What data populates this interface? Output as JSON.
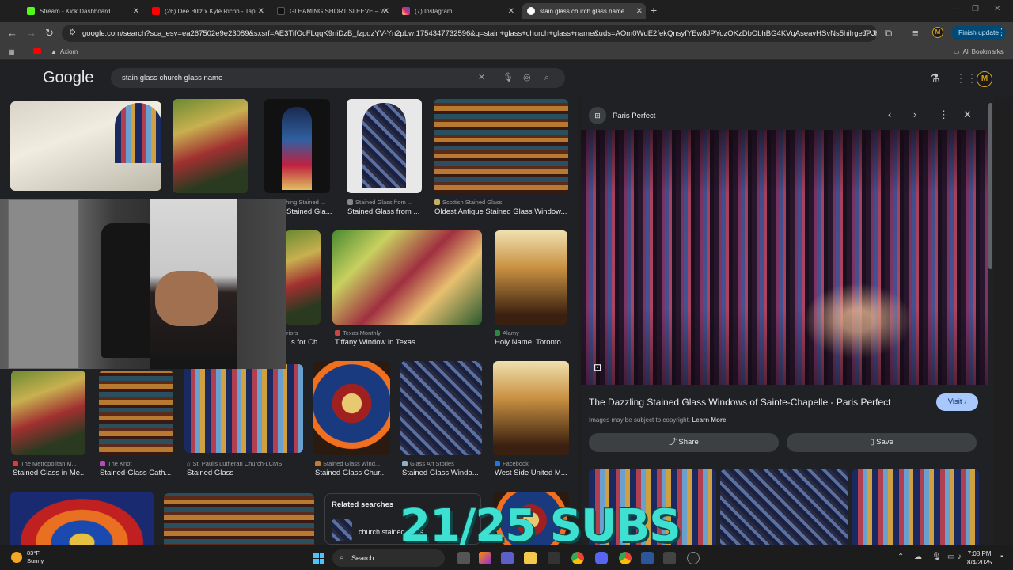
{
  "browser": {
    "tabs": [
      {
        "title": "Stream - Kick Dashboard",
        "icon": "kick-icon",
        "color": "#53fc18"
      },
      {
        "title": "(26) Dee Billz x Kyle Richh - Tap",
        "icon": "youtube-icon",
        "color": "#ff0000"
      },
      {
        "title": "GLEAMING SHORT SLEEVE – W",
        "icon": "shop-icon",
        "color": "#222222"
      },
      {
        "title": "(7) Instagram",
        "icon": "instagram-icon",
        "color": "#d62976"
      },
      {
        "title": "stain glass church glass name",
        "icon": "google-icon",
        "color": "#ffffff"
      }
    ],
    "address": "google.com/search?sca_esv=ea267502e9e23089&sxsrf=AE3TifOcFLqqK9niDzB_fzpqzYV-Yn2pLw:1754347732596&q=stain+glass+church+glass+name&uds=AOm0WdE2fekQnsyfYEw8JPYozOKzDbObhBG4KVqAseavHSvNs5hiIrgeJPJRLL...",
    "finish_update": "Finish update",
    "profile_letter": "M",
    "bookmarks": [
      {
        "label": ""
      },
      {
        "label": "Axiom"
      }
    ],
    "all_bookmarks": "All Bookmarks"
  },
  "google": {
    "logo": "Google",
    "query": "stain glass church glass name",
    "avatar_letter": "M"
  },
  "results": {
    "row1": [
      {
        "source": "",
        "title": ""
      },
      {
        "source": "",
        "title": ""
      },
      {
        "source": "thing Stained ...",
        "title": "Stained Gla..."
      },
      {
        "source": "Stained Glass from ...",
        "title": "Stained Glass from ..."
      },
      {
        "source": "Scottish Stained Glass",
        "title": "Oldest Antique Stained Glass Window..."
      }
    ],
    "row2": [
      {
        "source": "riors",
        "title": "s for Ch..."
      },
      {
        "source": "Texas Monthly",
        "title": "Tiffany Window in Texas"
      },
      {
        "source": "Alamy",
        "title": "Holy Name, Toronto..."
      }
    ],
    "row3": [
      {
        "source": "The Metropolitan M...",
        "title": "Stained Glass in Me..."
      },
      {
        "source": "The Knot",
        "title": "Stained-Glass Cath..."
      },
      {
        "source": "St. Paul's Lutheran Church-LCMS",
        "title": "Stained Glass"
      },
      {
        "source": "Stained Glass Wind...",
        "title": "Stained Glass Chur..."
      },
      {
        "source": "Glass Art Stories",
        "title": "Stained Glass Windo..."
      },
      {
        "source": "Facebook",
        "title": "West Side United M..."
      }
    ],
    "related_heading": "Related searches",
    "related_item": "church stained glass"
  },
  "preview": {
    "site": "Paris Perfect",
    "title": "The Dazzling Stained Glass Windows of Sainte-Chapelle - Paris Perfect",
    "visit": "Visit",
    "copyright": "Images may be subject to copyright.",
    "learn_more": "Learn More",
    "share": "Share",
    "save": "Save"
  },
  "overlay": {
    "subs": "21/25 SUBS"
  },
  "taskbar": {
    "temp": "83°F",
    "condition": "Sunny",
    "search": "Search",
    "time": "7:08 PM",
    "date": "8/4/2025"
  }
}
